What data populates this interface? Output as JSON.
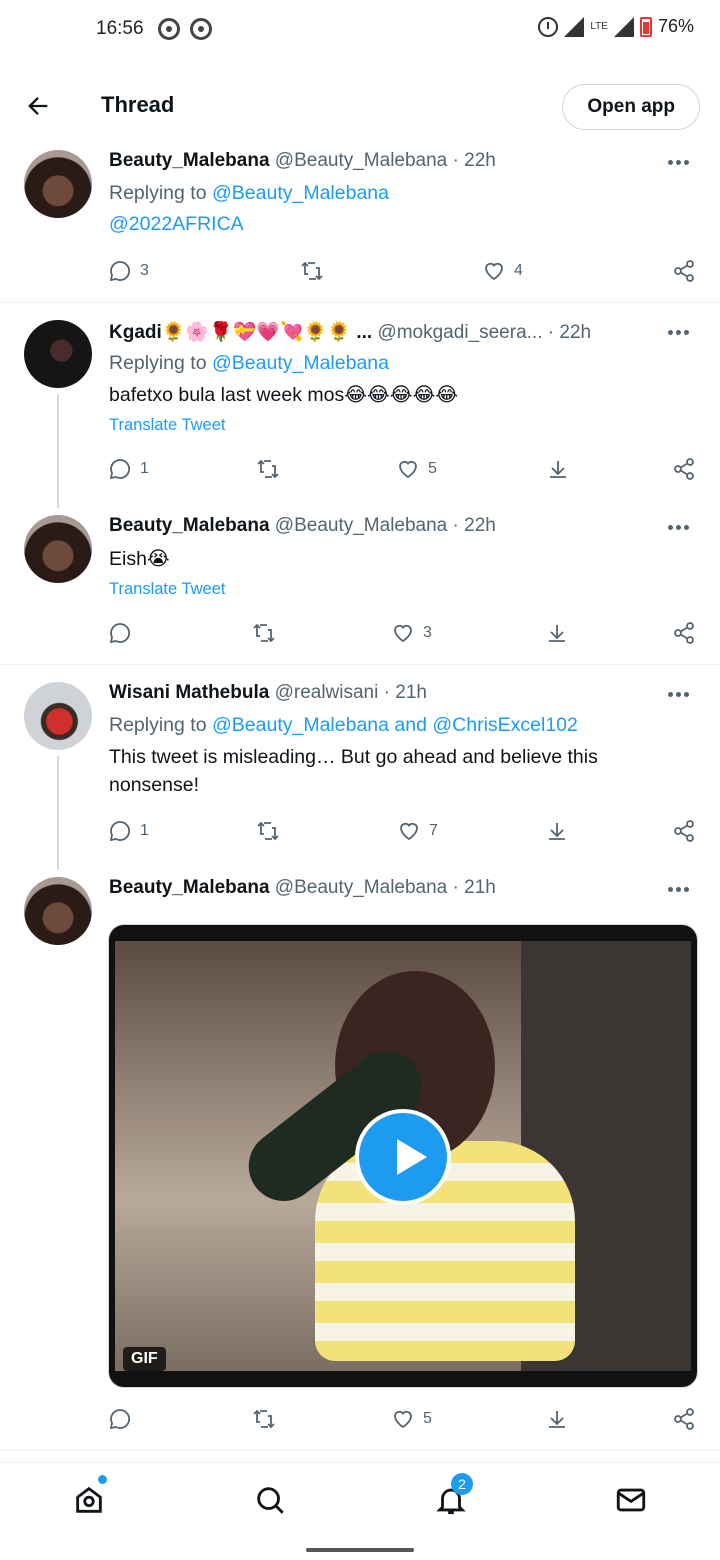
{
  "status_bar": {
    "time": "16:56",
    "lte": "LTE",
    "battery": "76%"
  },
  "header": {
    "title": "Thread",
    "open_app": "Open app"
  },
  "tweets": [
    {
      "name": "Beauty_Malebana",
      "handle": "@Beauty_Malebana",
      "time": "· 22h",
      "reply_prefix": "Replying to",
      "reply_to": "@Beauty_Malebana",
      "text": "@2022AFRICA",
      "replies": "3",
      "likes": "4"
    },
    {
      "name": "Kgadi🌻🌸🌹💝💗💘🌻🌻 ...",
      "handle": "@mokgadi_seera...",
      "time": "· 22h",
      "reply_prefix": "Replying to",
      "reply_to": "@Beauty_Malebana",
      "text": "bafetxo bula last week mos😂😂😂😂😂",
      "translate": "Translate Tweet",
      "replies": "1",
      "likes": "5"
    },
    {
      "name": "Beauty_Malebana",
      "handle": "@Beauty_Malebana",
      "time": "· 22h",
      "text": "Eish😭",
      "translate": "Translate Tweet",
      "likes": "3"
    },
    {
      "name": "Wisani Mathebula",
      "handle": "@realwisani",
      "time": "· 21h",
      "reply_prefix": "Replying to",
      "reply_to": "@Beauty_Malebana and @ChrisExcel102",
      "text": "This tweet is misleading… But go ahead and believe this nonsense!",
      "replies": "1",
      "likes": "7"
    },
    {
      "name": "Beauty_Malebana",
      "handle": "@Beauty_Malebana",
      "time": "· 21h",
      "media_badge": "GIF",
      "likes": "5"
    }
  ],
  "bottom_nav": {
    "notifications_count": "2"
  },
  "colors": {
    "accent": "#1d9bf0",
    "text": "#0f1419",
    "secondary": "#536471"
  }
}
